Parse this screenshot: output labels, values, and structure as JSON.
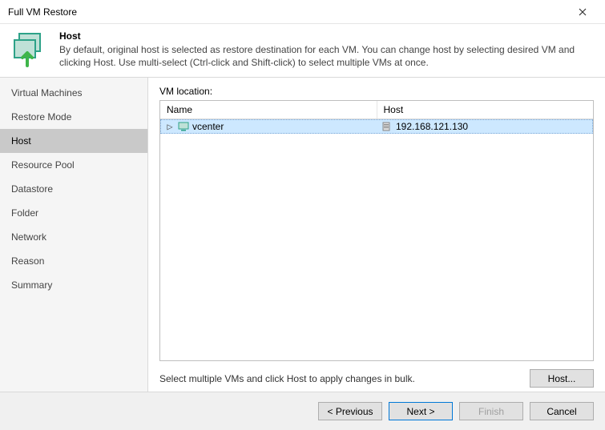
{
  "window": {
    "title": "Full VM Restore"
  },
  "header": {
    "title": "Host",
    "description": "By default, original host is selected as restore destination for each VM. You can change host by selecting desired VM and clicking Host. Use multi-select (Ctrl-click and Shift-click) to select multiple VMs at once."
  },
  "sidebar": {
    "items": [
      {
        "label": "Virtual Machines"
      },
      {
        "label": "Restore Mode"
      },
      {
        "label": "Host"
      },
      {
        "label": "Resource Pool"
      },
      {
        "label": "Datastore"
      },
      {
        "label": "Folder"
      },
      {
        "label": "Network"
      },
      {
        "label": "Reason"
      },
      {
        "label": "Summary"
      }
    ],
    "selected_index": 2
  },
  "main": {
    "section_label": "VM location:",
    "columns": [
      "Name",
      "Host"
    ],
    "rows": [
      {
        "name": "vcenter",
        "host": "192.168.121.130",
        "selected": true
      }
    ],
    "hint": "Select multiple VMs and click Host to apply changes in bulk.",
    "host_button": "Host..."
  },
  "footer": {
    "previous": "< Previous",
    "next": "Next >",
    "finish": "Finish",
    "cancel": "Cancel"
  }
}
